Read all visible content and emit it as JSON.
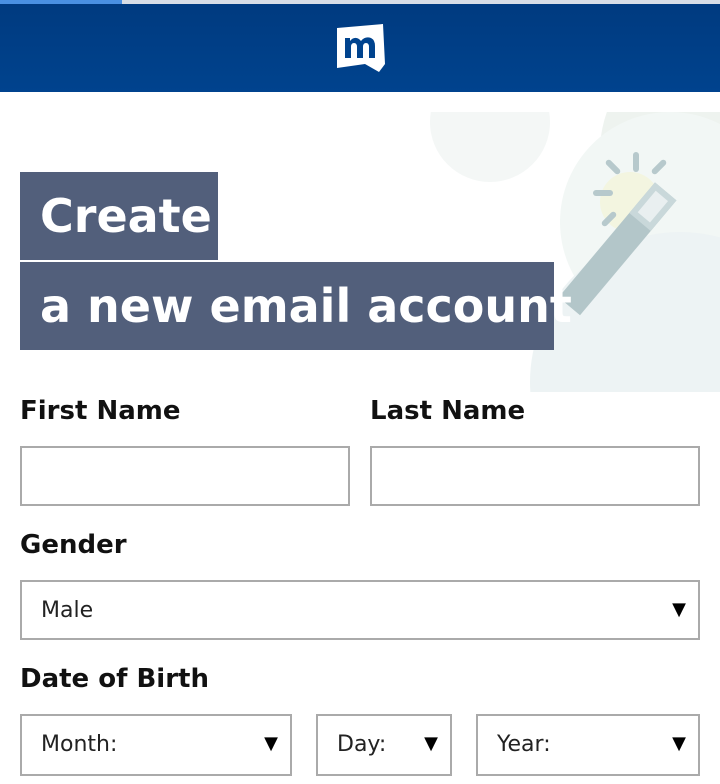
{
  "page": {
    "loading_progress": 0.17
  },
  "header": {
    "logo_icon": "mail-com-logo-icon"
  },
  "title": {
    "line1": "Create",
    "line2": "a new email account"
  },
  "form": {
    "first_name": {
      "label": "First Name",
      "value": ""
    },
    "last_name": {
      "label": "Last Name",
      "value": ""
    },
    "gender": {
      "label": "Gender",
      "selected": "Male"
    },
    "dob": {
      "label": "Date of Birth",
      "month": "Month:",
      "day": "Day:",
      "year": "Year:"
    }
  },
  "icons": {
    "select_arrow": "▼"
  },
  "colors": {
    "header_blue": "#00438e",
    "title_block": "#525f7b",
    "progress": "#4a90e2",
    "field_border": "#aaaaaa"
  }
}
